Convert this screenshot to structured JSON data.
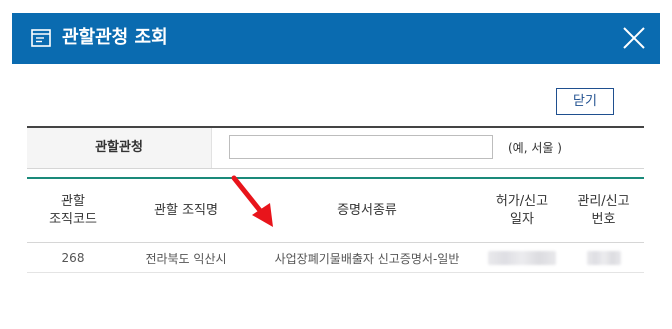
{
  "dialog": {
    "title": "관할관청 조회",
    "close_icon": "close-icon",
    "title_icon": "window-icon"
  },
  "toolbar": {
    "close_label": "닫기"
  },
  "search": {
    "label": "관할관청",
    "value": "",
    "placeholder": "",
    "hint": "(예, 서울 )"
  },
  "table": {
    "headers": {
      "org_code": [
        "관할",
        "조직코드"
      ],
      "org_name": "관할 조직명",
      "cert_type": "증명서종류",
      "permit_date": [
        "허가/신고",
        "일자"
      ],
      "mgmt_no": [
        "관리/신고",
        "번호"
      ]
    },
    "rows": [
      {
        "org_code": "268",
        "org_name": "전라북도 익산시",
        "cert_type": "사업장폐기물배출자 신고증명서-일반"
      }
    ]
  },
  "colors": {
    "titlebar": "#0a6bb0",
    "annotation_arrow": "#e8141b",
    "table_top_border": "#1a8a7a"
  }
}
